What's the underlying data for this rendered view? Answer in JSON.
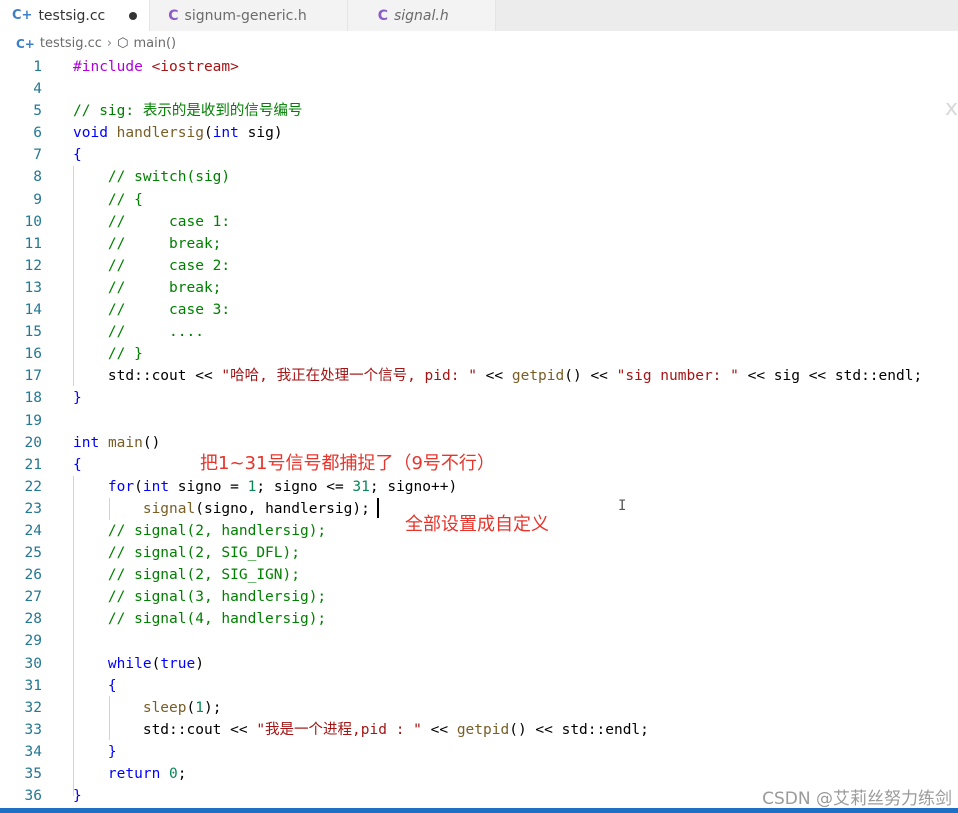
{
  "tabs": [
    {
      "label": "testsig.cc",
      "icon": "cpp-file-icon",
      "active": true,
      "dirty": true
    },
    {
      "label": "signum-generic.h",
      "icon": "c-file-icon",
      "active": false
    },
    {
      "label": "signal.h",
      "icon": "c-file-icon",
      "active": false,
      "italic": true
    }
  ],
  "breadcrumb": {
    "file": "testsig.cc",
    "symbol": "main()"
  },
  "lines": [
    {
      "n": "1",
      "html": "<span class=\"pp\">#include</span> <span class=\"st\">&lt;iostream&gt;</span>"
    },
    {
      "n": "4",
      "html": ""
    },
    {
      "n": "5",
      "html": "<span class=\"cm\">// sig: 表示的是收到的信号编号</span>"
    },
    {
      "n": "6",
      "html": "<span class=\"kw\">void</span> <span class=\"fn\">handlersig</span>(<span class=\"kw\">int</span> sig)"
    },
    {
      "n": "7",
      "html": "<span class=\"kw\">{</span>"
    },
    {
      "n": "8",
      "html": "    <span class=\"cm\">// switch(sig)</span>"
    },
    {
      "n": "9",
      "html": "    <span class=\"cm\">// {</span>"
    },
    {
      "n": "10",
      "html": "    <span class=\"cm\">//     case 1:</span>"
    },
    {
      "n": "11",
      "html": "    <span class=\"cm\">//     break;</span>"
    },
    {
      "n": "12",
      "html": "    <span class=\"cm\">//     case 2:</span>"
    },
    {
      "n": "13",
      "html": "    <span class=\"cm\">//     break;</span>"
    },
    {
      "n": "14",
      "html": "    <span class=\"cm\">//     case 3:</span>"
    },
    {
      "n": "15",
      "html": "    <span class=\"cm\">//     ....</span>"
    },
    {
      "n": "16",
      "html": "    <span class=\"cm\">// }</span>"
    },
    {
      "n": "17",
      "html": "    std::cout &lt;&lt; <span class=\"st\">\"哈哈, 我正在处理一个信号, pid: \"</span> &lt;&lt; <span class=\"fn\">getpid</span>() &lt;&lt; <span class=\"st\">\"sig number: \"</span> &lt;&lt; sig &lt;&lt; std::endl;"
    },
    {
      "n": "18",
      "html": "<span class=\"kw\">}</span>"
    },
    {
      "n": "19",
      "html": ""
    },
    {
      "n": "20",
      "html": "<span class=\"kw\">int</span> <span class=\"fn\">main</span>()"
    },
    {
      "n": "21",
      "html": "<span class=\"kw\">{</span>"
    },
    {
      "n": "22",
      "html": "    <span class=\"kw\">for</span>(<span class=\"kw\">int</span> signo = <span class=\"nm\">1</span>; signo &lt;= <span class=\"nm\">31</span>; signo++)"
    },
    {
      "n": "23",
      "html": "        <span class=\"fn\">signal</span>(signo, handlersig);"
    },
    {
      "n": "24",
      "html": "    <span class=\"cm\">// signal(2, handlersig);</span>"
    },
    {
      "n": "25",
      "html": "    <span class=\"cm\">// signal(2, SIG_DFL);</span>"
    },
    {
      "n": "26",
      "html": "    <span class=\"cm\">// signal(2, SIG_IGN);</span>"
    },
    {
      "n": "27",
      "html": "    <span class=\"cm\">// signal(3, handlersig);</span>"
    },
    {
      "n": "28",
      "html": "    <span class=\"cm\">// signal(4, handlersig);</span>"
    },
    {
      "n": "29",
      "html": ""
    },
    {
      "n": "30",
      "html": "    <span class=\"kw\">while</span>(<span class=\"kw\">true</span>)"
    },
    {
      "n": "31",
      "html": "    <span class=\"kw\">{</span>"
    },
    {
      "n": "32",
      "html": "        <span class=\"fn\">sleep</span>(<span class=\"nm\">1</span>);"
    },
    {
      "n": "33",
      "html": "        std::cout &lt;&lt; <span class=\"st\">\"我是一个进程,pid : \"</span> &lt;&lt; <span class=\"fn\">getpid</span>() &lt;&lt; std::endl;"
    },
    {
      "n": "34",
      "html": "    <span class=\"kw\">}</span>"
    },
    {
      "n": "35",
      "html": "    <span class=\"kw\">return</span> <span class=\"nm\">0</span>;"
    },
    {
      "n": "36",
      "html": "<span class=\"kw\">}</span>"
    }
  ],
  "annotations": {
    "note1": "把1~31号信号都捕捉了（9号不行）",
    "note2": "全部设置成自定义"
  },
  "watermark": "CSDN @艾莉丝努力练剑",
  "colors": {
    "keyword": "#0000ff",
    "comment": "#008000",
    "string": "#a31515",
    "function": "#795e26",
    "number": "#098658",
    "annotation": "#e5352c"
  }
}
